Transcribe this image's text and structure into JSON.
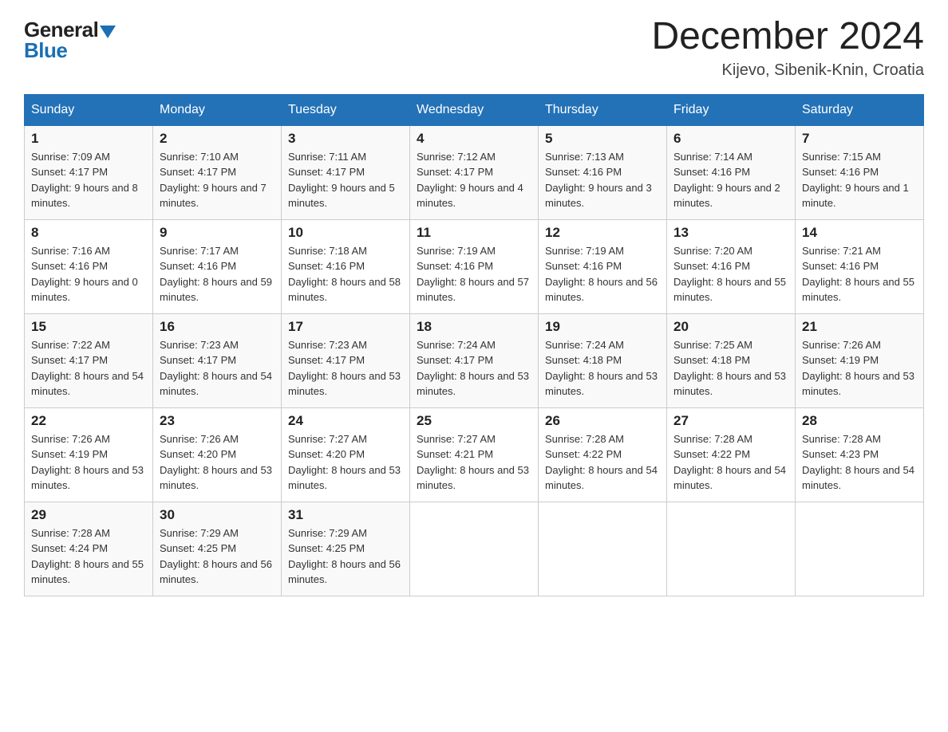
{
  "header": {
    "logo_general": "General",
    "logo_blue": "Blue",
    "month_title": "December 2024",
    "location": "Kijevo, Sibenik-Knin, Croatia"
  },
  "columns": [
    "Sunday",
    "Monday",
    "Tuesday",
    "Wednesday",
    "Thursday",
    "Friday",
    "Saturday"
  ],
  "weeks": [
    [
      {
        "day": "1",
        "sunrise": "7:09 AM",
        "sunset": "4:17 PM",
        "daylight": "9 hours and 8 minutes."
      },
      {
        "day": "2",
        "sunrise": "7:10 AM",
        "sunset": "4:17 PM",
        "daylight": "9 hours and 7 minutes."
      },
      {
        "day": "3",
        "sunrise": "7:11 AM",
        "sunset": "4:17 PM",
        "daylight": "9 hours and 5 minutes."
      },
      {
        "day": "4",
        "sunrise": "7:12 AM",
        "sunset": "4:17 PM",
        "daylight": "9 hours and 4 minutes."
      },
      {
        "day": "5",
        "sunrise": "7:13 AM",
        "sunset": "4:16 PM",
        "daylight": "9 hours and 3 minutes."
      },
      {
        "day": "6",
        "sunrise": "7:14 AM",
        "sunset": "4:16 PM",
        "daylight": "9 hours and 2 minutes."
      },
      {
        "day": "7",
        "sunrise": "7:15 AM",
        "sunset": "4:16 PM",
        "daylight": "9 hours and 1 minute."
      }
    ],
    [
      {
        "day": "8",
        "sunrise": "7:16 AM",
        "sunset": "4:16 PM",
        "daylight": "9 hours and 0 minutes."
      },
      {
        "day": "9",
        "sunrise": "7:17 AM",
        "sunset": "4:16 PM",
        "daylight": "8 hours and 59 minutes."
      },
      {
        "day": "10",
        "sunrise": "7:18 AM",
        "sunset": "4:16 PM",
        "daylight": "8 hours and 58 minutes."
      },
      {
        "day": "11",
        "sunrise": "7:19 AM",
        "sunset": "4:16 PM",
        "daylight": "8 hours and 57 minutes."
      },
      {
        "day": "12",
        "sunrise": "7:19 AM",
        "sunset": "4:16 PM",
        "daylight": "8 hours and 56 minutes."
      },
      {
        "day": "13",
        "sunrise": "7:20 AM",
        "sunset": "4:16 PM",
        "daylight": "8 hours and 55 minutes."
      },
      {
        "day": "14",
        "sunrise": "7:21 AM",
        "sunset": "4:16 PM",
        "daylight": "8 hours and 55 minutes."
      }
    ],
    [
      {
        "day": "15",
        "sunrise": "7:22 AM",
        "sunset": "4:17 PM",
        "daylight": "8 hours and 54 minutes."
      },
      {
        "day": "16",
        "sunrise": "7:23 AM",
        "sunset": "4:17 PM",
        "daylight": "8 hours and 54 minutes."
      },
      {
        "day": "17",
        "sunrise": "7:23 AM",
        "sunset": "4:17 PM",
        "daylight": "8 hours and 53 minutes."
      },
      {
        "day": "18",
        "sunrise": "7:24 AM",
        "sunset": "4:17 PM",
        "daylight": "8 hours and 53 minutes."
      },
      {
        "day": "19",
        "sunrise": "7:24 AM",
        "sunset": "4:18 PM",
        "daylight": "8 hours and 53 minutes."
      },
      {
        "day": "20",
        "sunrise": "7:25 AM",
        "sunset": "4:18 PM",
        "daylight": "8 hours and 53 minutes."
      },
      {
        "day": "21",
        "sunrise": "7:26 AM",
        "sunset": "4:19 PM",
        "daylight": "8 hours and 53 minutes."
      }
    ],
    [
      {
        "day": "22",
        "sunrise": "7:26 AM",
        "sunset": "4:19 PM",
        "daylight": "8 hours and 53 minutes."
      },
      {
        "day": "23",
        "sunrise": "7:26 AM",
        "sunset": "4:20 PM",
        "daylight": "8 hours and 53 minutes."
      },
      {
        "day": "24",
        "sunrise": "7:27 AM",
        "sunset": "4:20 PM",
        "daylight": "8 hours and 53 minutes."
      },
      {
        "day": "25",
        "sunrise": "7:27 AM",
        "sunset": "4:21 PM",
        "daylight": "8 hours and 53 minutes."
      },
      {
        "day": "26",
        "sunrise": "7:28 AM",
        "sunset": "4:22 PM",
        "daylight": "8 hours and 54 minutes."
      },
      {
        "day": "27",
        "sunrise": "7:28 AM",
        "sunset": "4:22 PM",
        "daylight": "8 hours and 54 minutes."
      },
      {
        "day": "28",
        "sunrise": "7:28 AM",
        "sunset": "4:23 PM",
        "daylight": "8 hours and 54 minutes."
      }
    ],
    [
      {
        "day": "29",
        "sunrise": "7:28 AM",
        "sunset": "4:24 PM",
        "daylight": "8 hours and 55 minutes."
      },
      {
        "day": "30",
        "sunrise": "7:29 AM",
        "sunset": "4:25 PM",
        "daylight": "8 hours and 56 minutes."
      },
      {
        "day": "31",
        "sunrise": "7:29 AM",
        "sunset": "4:25 PM",
        "daylight": "8 hours and 56 minutes."
      },
      null,
      null,
      null,
      null
    ]
  ],
  "labels": {
    "sunrise": "Sunrise:",
    "sunset": "Sunset:",
    "daylight": "Daylight:"
  }
}
